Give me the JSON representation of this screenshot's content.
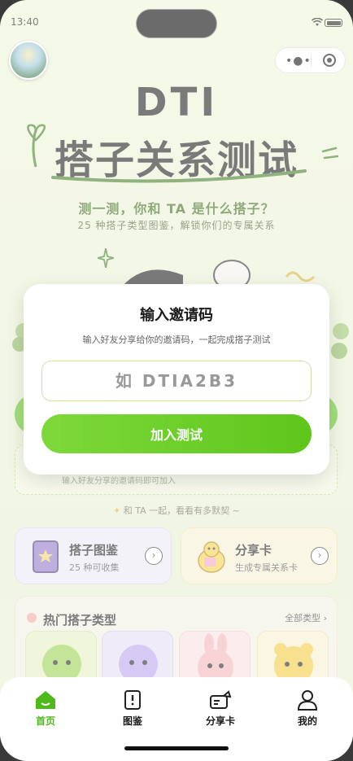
{
  "status_bar": {
    "time": "13:40"
  },
  "hero": {
    "title_line1": "DTI",
    "title_line2": "搭子关系测试",
    "subtitle": "测一测，你和 TA 是什么搭子？",
    "tagline": "25 种搭子类型图鉴，解锁你们的专属关系"
  },
  "modal": {
    "title": "输入邀请码",
    "subtitle": "输入好友分享给你的邀请码，一起完成搭子测试",
    "input_placeholder": "如 DTIA2B3",
    "input_value": "",
    "join_label": "加入测试"
  },
  "invite_card": {
    "hint": "输入好友分享的邀请码即可加入"
  },
  "together_text": "和 TA 一起，看看有多默契 ~",
  "features": [
    {
      "title": "搭子图鉴",
      "subtitle": "25 种可收集",
      "icon": "book-icon"
    },
    {
      "title": "分享卡",
      "subtitle": "生成专属关系卡",
      "icon": "chick-icon"
    }
  ],
  "hot_types": {
    "title": "热门搭子类型",
    "all_label": "全部类型",
    "cards": [
      {
        "color": "#e3efc2",
        "creature": "green-fluffy"
      },
      {
        "color": "#e4ddf4",
        "creature": "purple-fluffy"
      },
      {
        "color": "#f8e0e0",
        "creature": "pink-bunny"
      },
      {
        "color": "#f6efcf",
        "creature": "yellow-bear"
      }
    ]
  },
  "tab_bar": {
    "items": [
      {
        "label": "首页",
        "icon": "home-icon",
        "active": true
      },
      {
        "label": "图鉴",
        "icon": "book-icon",
        "active": false
      },
      {
        "label": "分享卡",
        "icon": "share-card-icon",
        "active": false
      },
      {
        "label": "我的",
        "icon": "profile-icon",
        "active": false
      }
    ]
  },
  "colors": {
    "accent": "#5ec61b",
    "tab_active": "#4fb81a",
    "title": "#1a1a1a",
    "subtitle_green": "#3f6b1e"
  }
}
